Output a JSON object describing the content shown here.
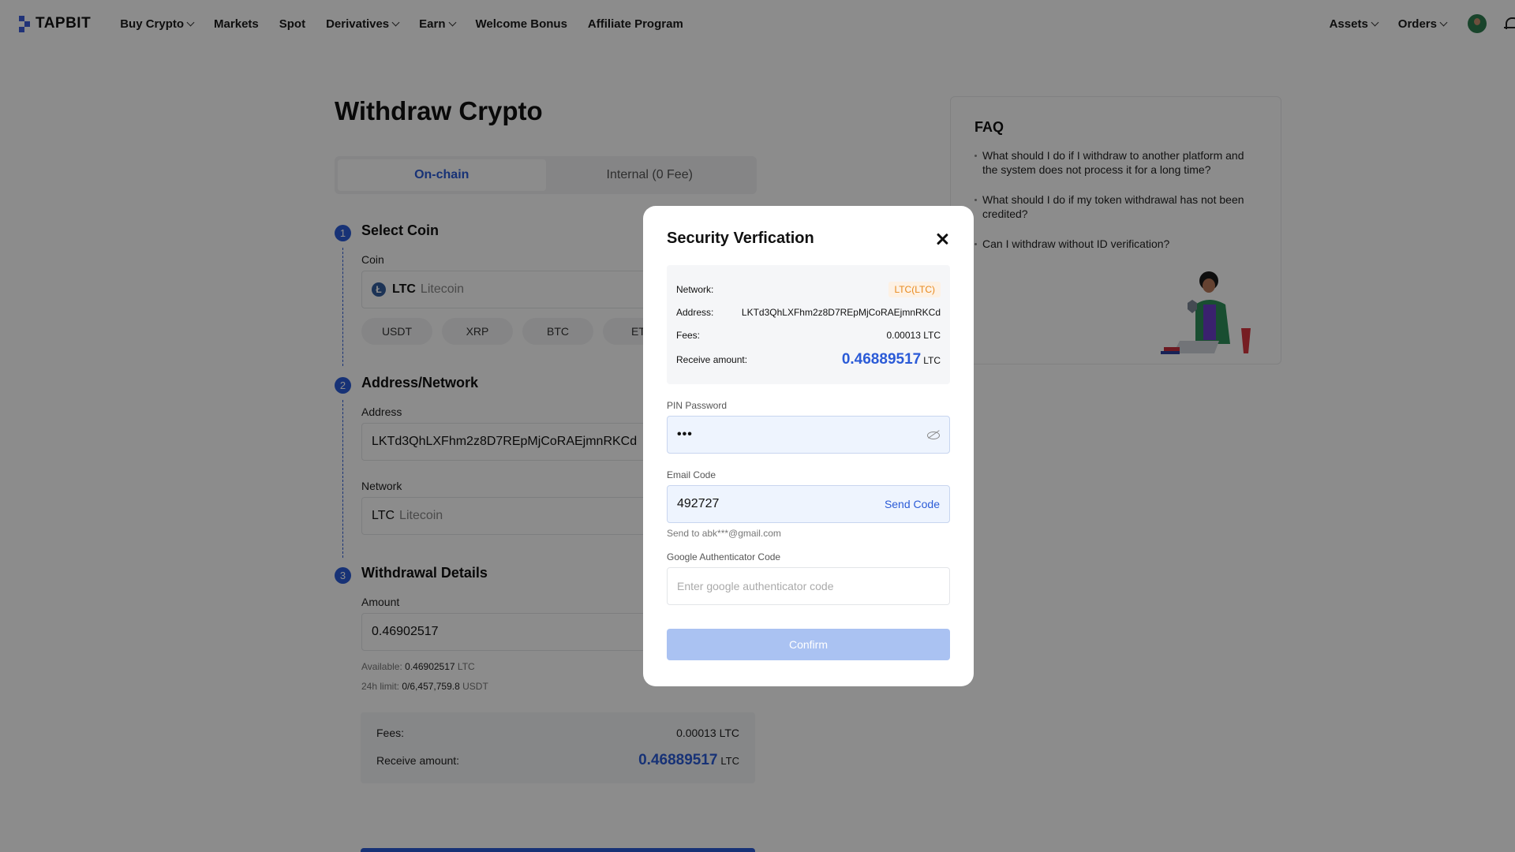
{
  "brand": {
    "name": "TAPBIT",
    "color": "#3b5bdb"
  },
  "nav": {
    "items": [
      {
        "label": "Buy Crypto",
        "dropdown": true
      },
      {
        "label": "Markets",
        "dropdown": false
      },
      {
        "label": "Spot",
        "dropdown": false
      },
      {
        "label": "Derivatives",
        "dropdown": true
      },
      {
        "label": "Earn",
        "dropdown": true
      },
      {
        "label": "Welcome Bonus",
        "dropdown": false
      },
      {
        "label": "Affiliate Program",
        "dropdown": false
      }
    ],
    "right": {
      "assets": "Assets",
      "orders": "Orders"
    }
  },
  "page": {
    "title": "Withdraw Crypto",
    "tabs": [
      "On-chain",
      "Internal (0 Fee)"
    ],
    "active_tab": 0,
    "step1": {
      "num": "1",
      "title": "Select Coin",
      "coin_label": "Coin",
      "coin_symbol": "LTC",
      "coin_name": "Litecoin",
      "coin_icon": "Ł",
      "chips": [
        "USDT",
        "XRP",
        "BTC",
        "ET"
      ]
    },
    "step2": {
      "num": "2",
      "title": "Address/Network",
      "address_label": "Address",
      "address_value": "LKTd3QhLXFhm2z8D7REpMjCoRAEjmnRKCd",
      "network_label": "Network",
      "network_symbol": "LTC",
      "network_name": "Litecoin"
    },
    "step3": {
      "num": "3",
      "title": "Withdrawal Details",
      "amount_label": "Amount",
      "amount_value": "0.46902517",
      "available_label": "Available:",
      "available_value": "0.46902517",
      "available_unit": "LTC",
      "limit_label": "24h limit:",
      "limit_value": "0/6,457,759.8",
      "limit_unit": "USDT",
      "fees_label": "Fees:",
      "fees_value": "0.00013 LTC",
      "receive_label": "Receive amount:",
      "receive_value": "0.46889517",
      "receive_unit": "LTC"
    }
  },
  "faq": {
    "title": "FAQ",
    "items": [
      "What should I do if I withdraw to another platform and the system does not process it for a long time?",
      "What should I do if my token withdrawal has not been credited?",
      "Can I withdraw without ID verification?"
    ]
  },
  "modal": {
    "title": "Security Verfication",
    "network_label": "Network:",
    "network_value": "LTC(LTC)",
    "address_label": "Address:",
    "address_value": "LKTd3QhLXFhm2z8D7REpMjCoRAEjmnRKCd",
    "fees_label": "Fees:",
    "fees_value": "0.00013 LTC",
    "receive_label": "Receive amount:",
    "receive_value": "0.46889517",
    "receive_unit": "LTC",
    "pin_label": "PIN Password",
    "pin_value": "•••",
    "email_label": "Email Code",
    "email_value": "492727",
    "send_code": "Send Code",
    "send_note": "Send to abk***@gmail.com",
    "google_label": "Google Authenticator Code",
    "google_placeholder": "Enter google authenticator code",
    "confirm": "Confirm"
  },
  "colors": {
    "accent": "#2b5bd7",
    "badge": "#e8891c",
    "confirm_disabled": "#aac2f2"
  }
}
